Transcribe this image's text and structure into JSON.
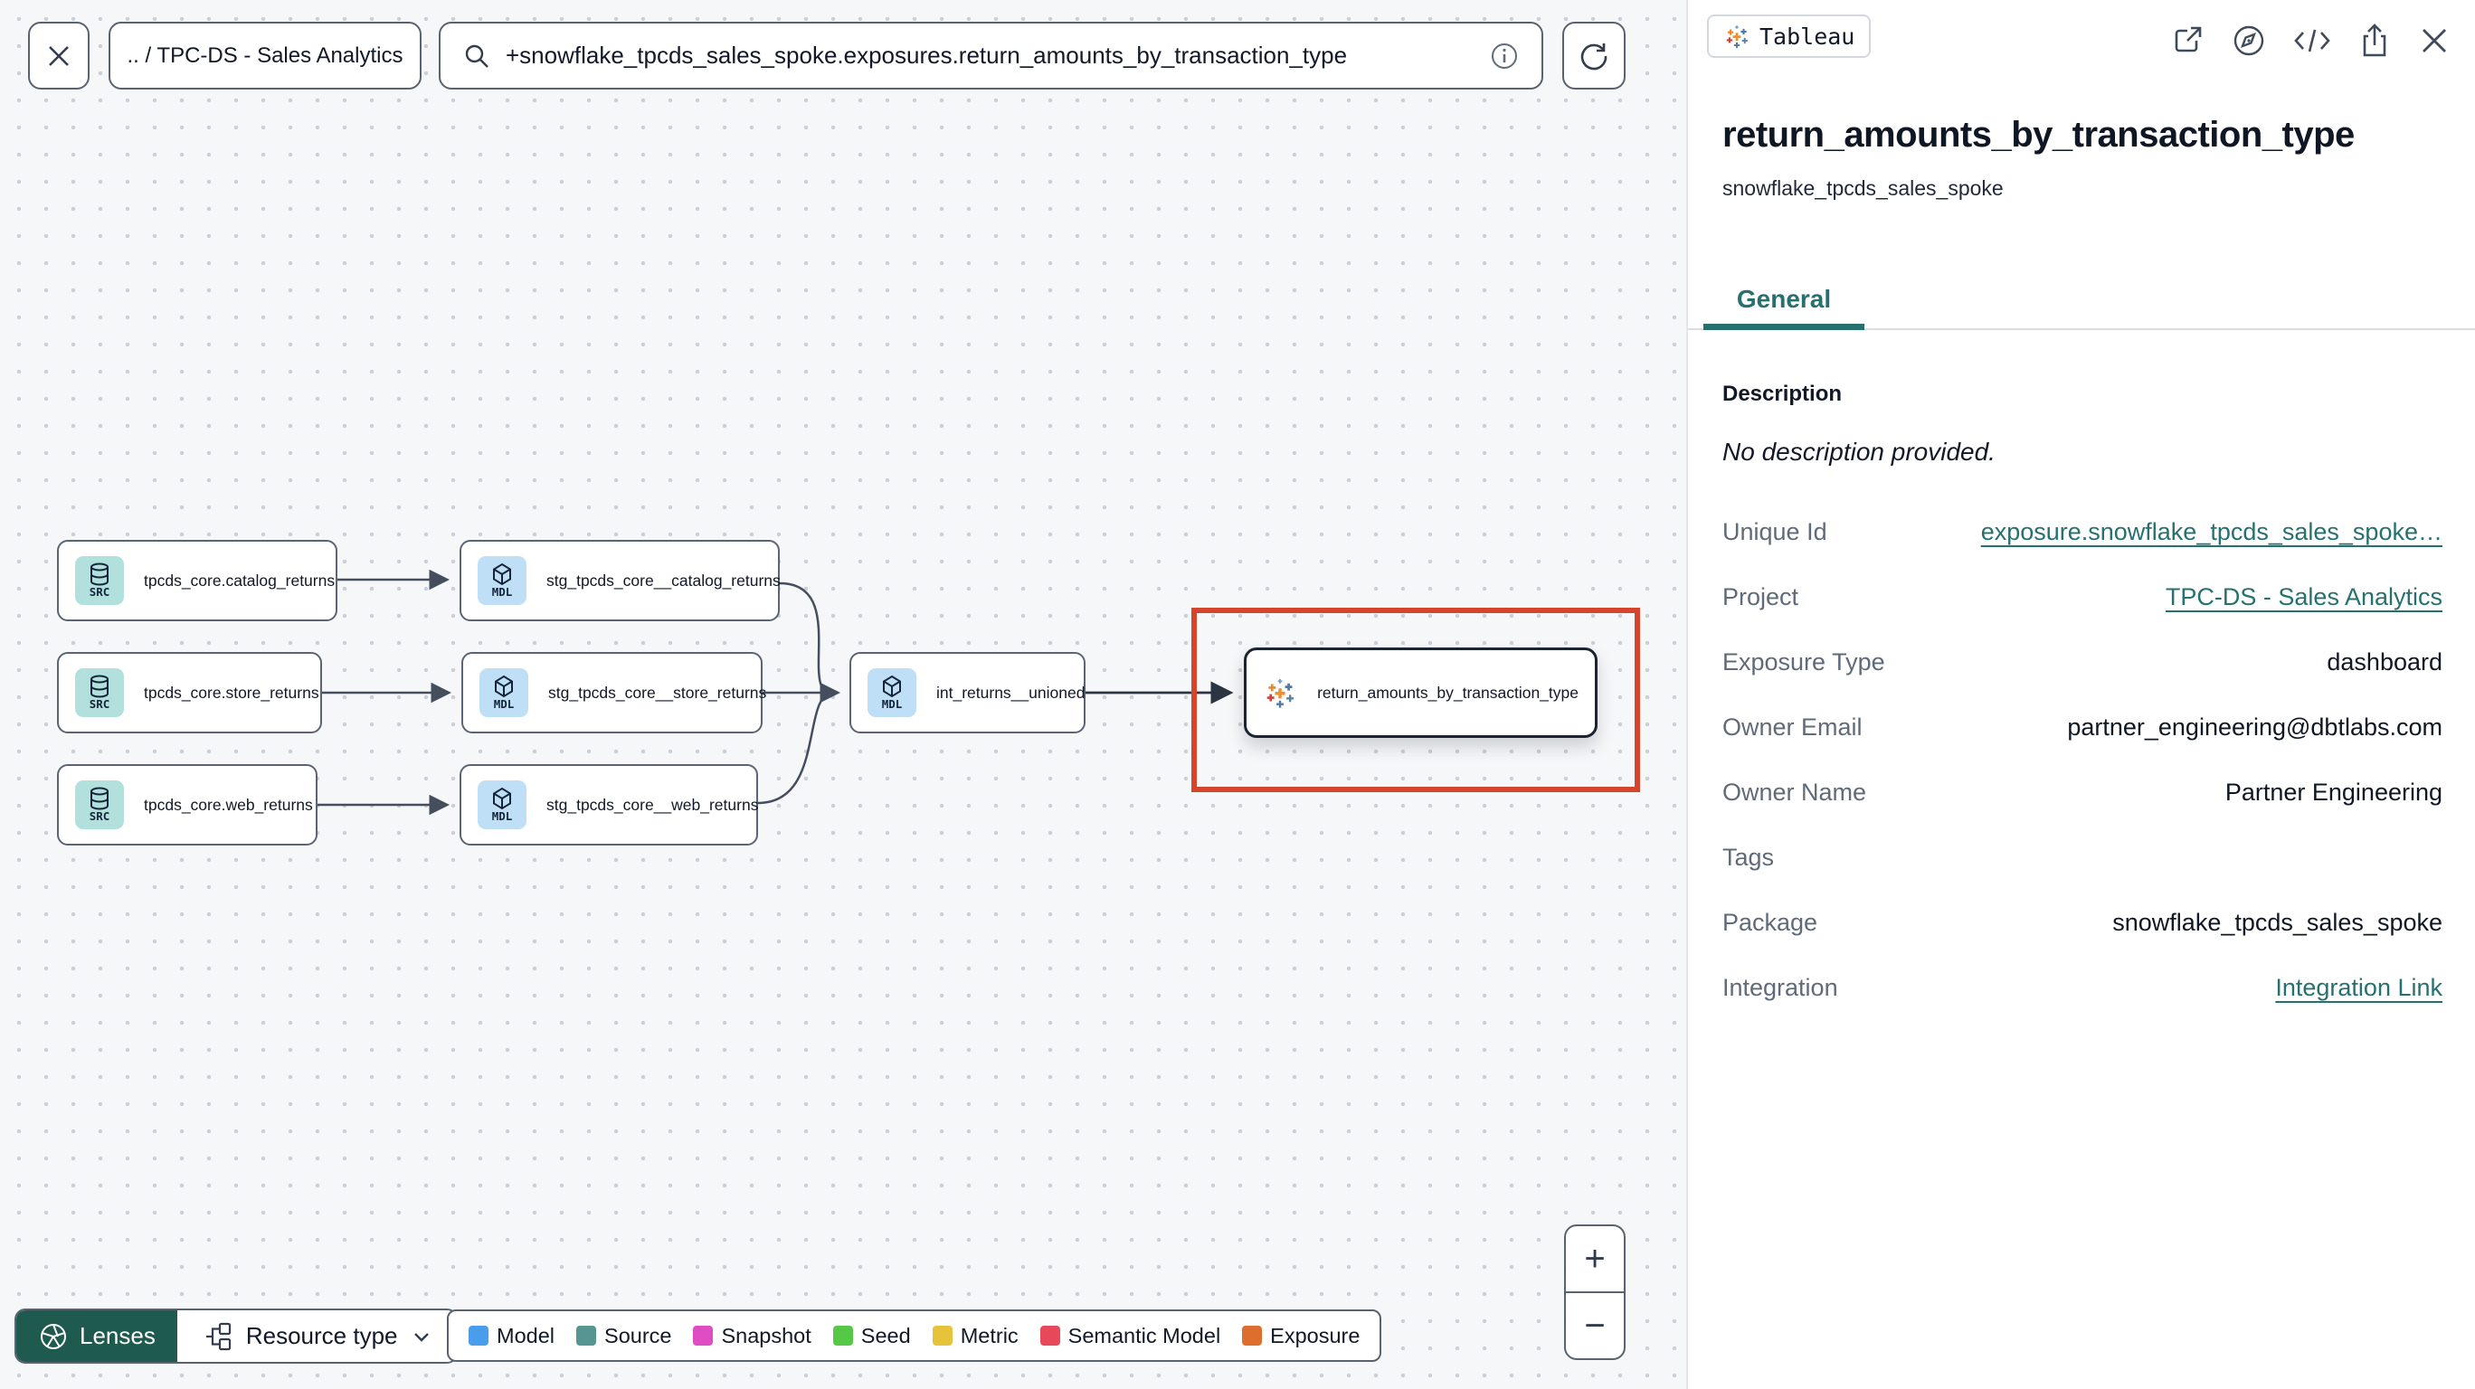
{
  "toolbar": {
    "breadcrumb": ".. / TPC-DS - Sales Analytics",
    "search_value": "+snowflake_tpcds_sales_spoke.exposures.return_amounts_by_transaction_type"
  },
  "graph": {
    "nodes": [
      {
        "type": "source",
        "badge": "SRC",
        "label": "tpcds_core.catalog_returns"
      },
      {
        "type": "source",
        "badge": "SRC",
        "label": "tpcds_core.store_returns"
      },
      {
        "type": "source",
        "badge": "SRC",
        "label": "tpcds_core.web_returns"
      },
      {
        "type": "model",
        "badge": "MDL",
        "label": "stg_tpcds_core__catalog_returns"
      },
      {
        "type": "model",
        "badge": "MDL",
        "label": "stg_tpcds_core__store_returns"
      },
      {
        "type": "model",
        "badge": "MDL",
        "label": "stg_tpcds_core__web_returns"
      },
      {
        "type": "model",
        "badge": "MDL",
        "label": "int_returns__unioned"
      },
      {
        "type": "exposure",
        "badge": "",
        "label": "return_amounts_by_transaction_type",
        "selected": true,
        "highlight_color": "#d5452c"
      }
    ]
  },
  "legend": {
    "items": [
      {
        "label": "Model",
        "color": "#4a9deb"
      },
      {
        "label": "Source",
        "color": "#579592"
      },
      {
        "label": "Snapshot",
        "color": "#df4cc4"
      },
      {
        "label": "Seed",
        "color": "#55c946"
      },
      {
        "label": "Metric",
        "color": "#e7c33c"
      },
      {
        "label": "Semantic Model",
        "color": "#e8495a"
      },
      {
        "label": "Exposure",
        "color": "#de6e2e"
      }
    ]
  },
  "controls": {
    "lenses_label": "Lenses",
    "resource_type_label": "Resource type",
    "zoom_in": "+",
    "zoom_out": "−"
  },
  "panel": {
    "integration_badge": "Tableau",
    "title": "return_amounts_by_transaction_type",
    "subtitle": "snowflake_tpcds_sales_spoke",
    "accent_color": "#26716f",
    "tabs": [
      {
        "label": "General",
        "active": true
      }
    ],
    "description_label": "Description",
    "description_value": "No description provided.",
    "fields": [
      {
        "label": "Unique Id",
        "value": "exposure.snowflake_tpcds_sales_spoke…",
        "link": true
      },
      {
        "label": "Project",
        "value": "TPC-DS - Sales Analytics",
        "link": true
      },
      {
        "label": "Exposure Type",
        "value": "dashboard",
        "link": false
      },
      {
        "label": "Owner Email",
        "value": "partner_engineering@dbtlabs.com",
        "link": false
      },
      {
        "label": "Owner Name",
        "value": "Partner Engineering",
        "link": false
      },
      {
        "label": "Tags",
        "value": "",
        "link": false
      },
      {
        "label": "Package",
        "value": "snowflake_tpcds_sales_spoke",
        "link": false
      },
      {
        "label": "Integration",
        "value": "Integration Link",
        "link": true
      }
    ]
  },
  "icons": {
    "close": "x-mark",
    "search": "magnifier",
    "info": "circled-i",
    "refresh": "circular-arrow",
    "external_link": "arrow-out-of-box",
    "explore": "compass",
    "code": "angle-brackets",
    "share": "box-with-up-arrow",
    "lenses": "aperture",
    "resource_type": "org-chart",
    "chevron_down": "chevron",
    "source_node": "database-cylinder",
    "model_node": "cube",
    "exposure_node": "tableau-logo"
  }
}
